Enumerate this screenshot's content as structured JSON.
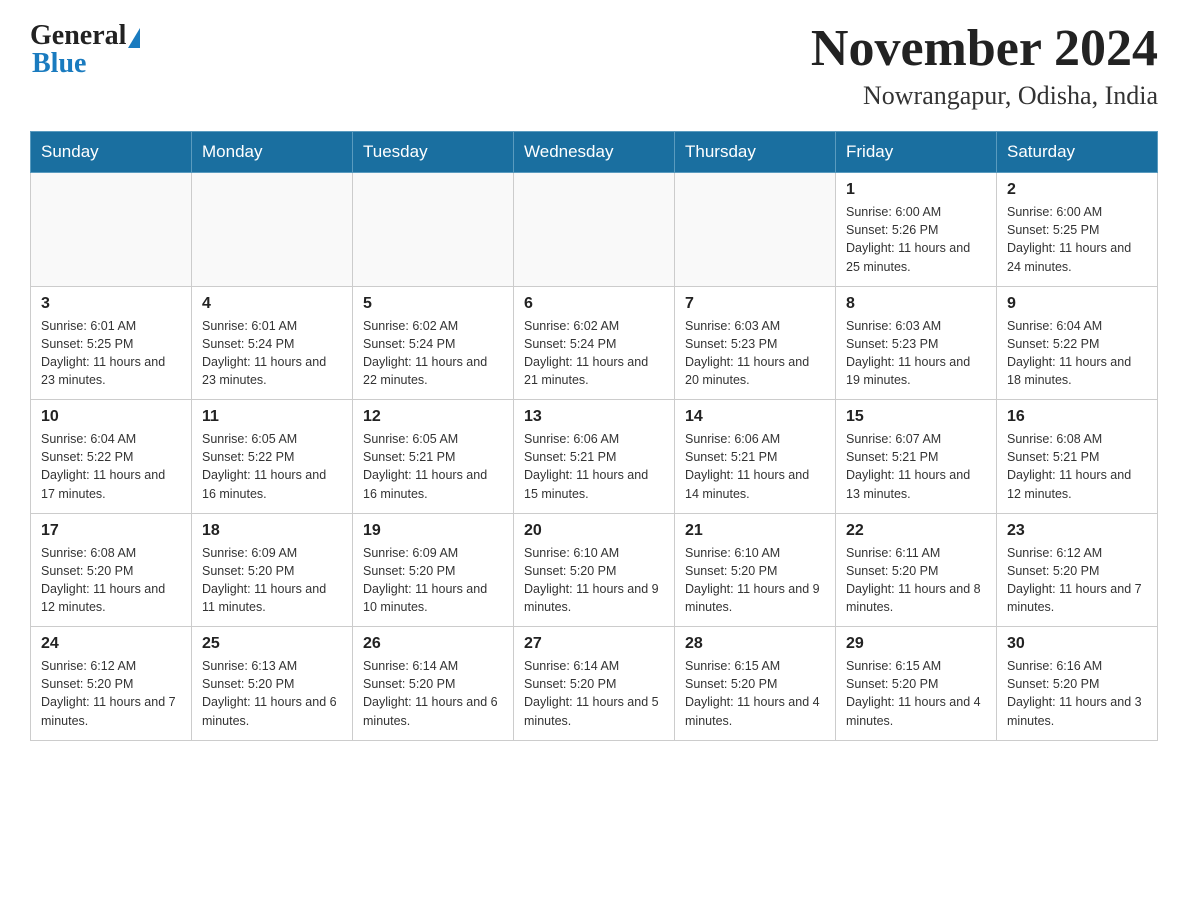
{
  "header": {
    "logo_general": "General",
    "logo_blue": "Blue",
    "month_title": "November 2024",
    "location": "Nowrangapur, Odisha, India"
  },
  "days_of_week": [
    "Sunday",
    "Monday",
    "Tuesday",
    "Wednesday",
    "Thursday",
    "Friday",
    "Saturday"
  ],
  "weeks": [
    [
      {
        "day": "",
        "info": ""
      },
      {
        "day": "",
        "info": ""
      },
      {
        "day": "",
        "info": ""
      },
      {
        "day": "",
        "info": ""
      },
      {
        "day": "",
        "info": ""
      },
      {
        "day": "1",
        "info": "Sunrise: 6:00 AM\nSunset: 5:26 PM\nDaylight: 11 hours and 25 minutes."
      },
      {
        "day": "2",
        "info": "Sunrise: 6:00 AM\nSunset: 5:25 PM\nDaylight: 11 hours and 24 minutes."
      }
    ],
    [
      {
        "day": "3",
        "info": "Sunrise: 6:01 AM\nSunset: 5:25 PM\nDaylight: 11 hours and 23 minutes."
      },
      {
        "day": "4",
        "info": "Sunrise: 6:01 AM\nSunset: 5:24 PM\nDaylight: 11 hours and 23 minutes."
      },
      {
        "day": "5",
        "info": "Sunrise: 6:02 AM\nSunset: 5:24 PM\nDaylight: 11 hours and 22 minutes."
      },
      {
        "day": "6",
        "info": "Sunrise: 6:02 AM\nSunset: 5:24 PM\nDaylight: 11 hours and 21 minutes."
      },
      {
        "day": "7",
        "info": "Sunrise: 6:03 AM\nSunset: 5:23 PM\nDaylight: 11 hours and 20 minutes."
      },
      {
        "day": "8",
        "info": "Sunrise: 6:03 AM\nSunset: 5:23 PM\nDaylight: 11 hours and 19 minutes."
      },
      {
        "day": "9",
        "info": "Sunrise: 6:04 AM\nSunset: 5:22 PM\nDaylight: 11 hours and 18 minutes."
      }
    ],
    [
      {
        "day": "10",
        "info": "Sunrise: 6:04 AM\nSunset: 5:22 PM\nDaylight: 11 hours and 17 minutes."
      },
      {
        "day": "11",
        "info": "Sunrise: 6:05 AM\nSunset: 5:22 PM\nDaylight: 11 hours and 16 minutes."
      },
      {
        "day": "12",
        "info": "Sunrise: 6:05 AM\nSunset: 5:21 PM\nDaylight: 11 hours and 16 minutes."
      },
      {
        "day": "13",
        "info": "Sunrise: 6:06 AM\nSunset: 5:21 PM\nDaylight: 11 hours and 15 minutes."
      },
      {
        "day": "14",
        "info": "Sunrise: 6:06 AM\nSunset: 5:21 PM\nDaylight: 11 hours and 14 minutes."
      },
      {
        "day": "15",
        "info": "Sunrise: 6:07 AM\nSunset: 5:21 PM\nDaylight: 11 hours and 13 minutes."
      },
      {
        "day": "16",
        "info": "Sunrise: 6:08 AM\nSunset: 5:21 PM\nDaylight: 11 hours and 12 minutes."
      }
    ],
    [
      {
        "day": "17",
        "info": "Sunrise: 6:08 AM\nSunset: 5:20 PM\nDaylight: 11 hours and 12 minutes."
      },
      {
        "day": "18",
        "info": "Sunrise: 6:09 AM\nSunset: 5:20 PM\nDaylight: 11 hours and 11 minutes."
      },
      {
        "day": "19",
        "info": "Sunrise: 6:09 AM\nSunset: 5:20 PM\nDaylight: 11 hours and 10 minutes."
      },
      {
        "day": "20",
        "info": "Sunrise: 6:10 AM\nSunset: 5:20 PM\nDaylight: 11 hours and 9 minutes."
      },
      {
        "day": "21",
        "info": "Sunrise: 6:10 AM\nSunset: 5:20 PM\nDaylight: 11 hours and 9 minutes."
      },
      {
        "day": "22",
        "info": "Sunrise: 6:11 AM\nSunset: 5:20 PM\nDaylight: 11 hours and 8 minutes."
      },
      {
        "day": "23",
        "info": "Sunrise: 6:12 AM\nSunset: 5:20 PM\nDaylight: 11 hours and 7 minutes."
      }
    ],
    [
      {
        "day": "24",
        "info": "Sunrise: 6:12 AM\nSunset: 5:20 PM\nDaylight: 11 hours and 7 minutes."
      },
      {
        "day": "25",
        "info": "Sunrise: 6:13 AM\nSunset: 5:20 PM\nDaylight: 11 hours and 6 minutes."
      },
      {
        "day": "26",
        "info": "Sunrise: 6:14 AM\nSunset: 5:20 PM\nDaylight: 11 hours and 6 minutes."
      },
      {
        "day": "27",
        "info": "Sunrise: 6:14 AM\nSunset: 5:20 PM\nDaylight: 11 hours and 5 minutes."
      },
      {
        "day": "28",
        "info": "Sunrise: 6:15 AM\nSunset: 5:20 PM\nDaylight: 11 hours and 4 minutes."
      },
      {
        "day": "29",
        "info": "Sunrise: 6:15 AM\nSunset: 5:20 PM\nDaylight: 11 hours and 4 minutes."
      },
      {
        "day": "30",
        "info": "Sunrise: 6:16 AM\nSunset: 5:20 PM\nDaylight: 11 hours and 3 minutes."
      }
    ]
  ]
}
